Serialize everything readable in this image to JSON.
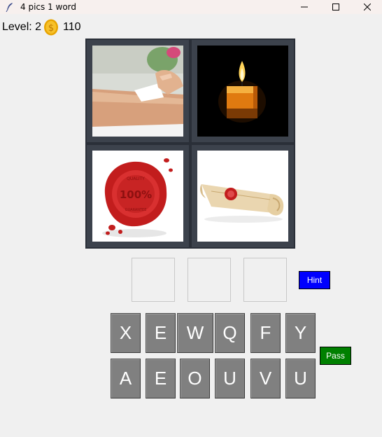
{
  "window": {
    "title": "4 pics 1 word"
  },
  "header": {
    "level_label": "Level: 2",
    "coins": "110"
  },
  "pictures": [
    {
      "name": "waxing-photo"
    },
    {
      "name": "candle-photo"
    },
    {
      "name": "wax-seal-photo"
    },
    {
      "name": "sealed-scroll-photo"
    }
  ],
  "answer_slots": [
    "",
    "",
    ""
  ],
  "buttons": {
    "hint": "Hint",
    "pass": "Pass"
  },
  "keyboard": {
    "row1": [
      "X",
      "E",
      "W",
      "Q",
      "F",
      "Y"
    ],
    "row2": [
      "A",
      "E",
      "O",
      "U",
      "V",
      "U"
    ]
  },
  "colors": {
    "hint_bg": "#0000ff",
    "pass_bg": "#008000",
    "key_bg": "#808080",
    "grid_frame": "#2a2f38"
  },
  "icons": [
    "feather-icon",
    "minimize-icon",
    "maximize-icon",
    "close-icon",
    "coin-icon"
  ]
}
